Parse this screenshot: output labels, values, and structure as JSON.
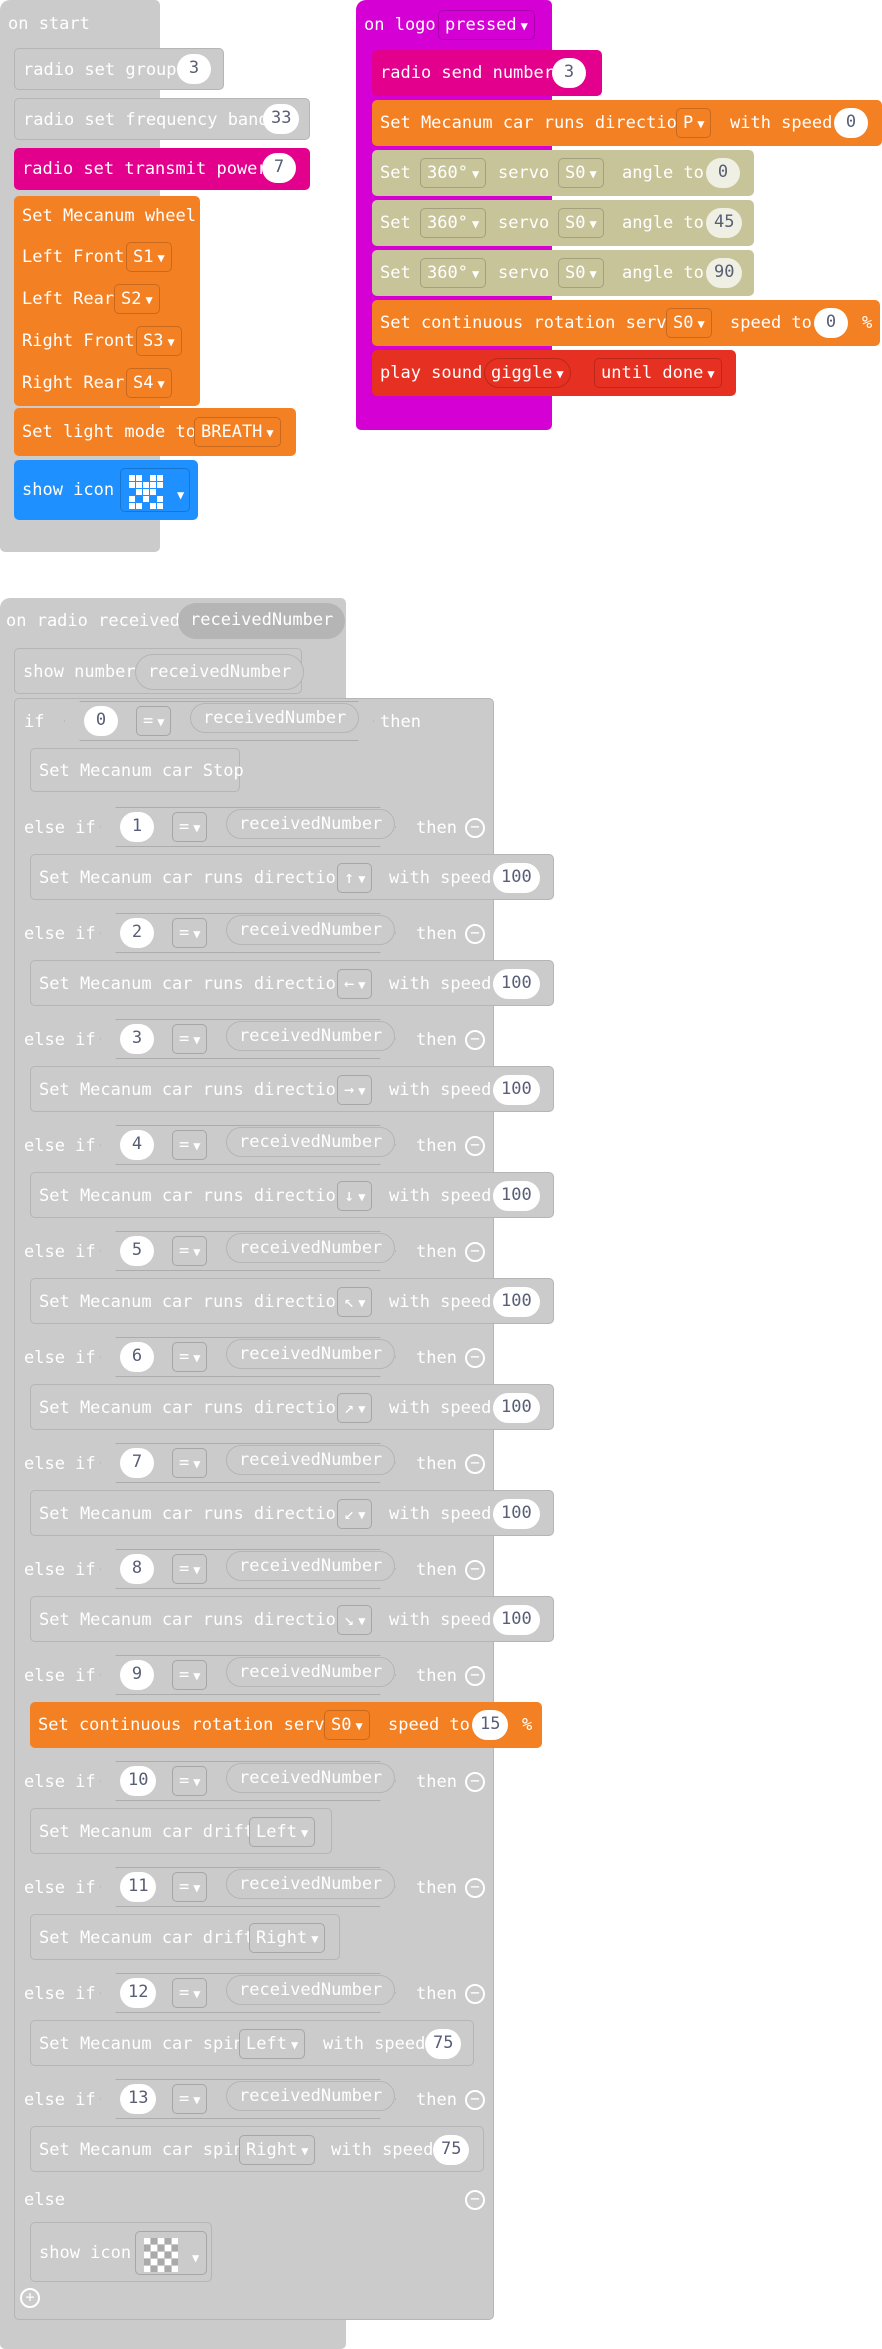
{
  "colors": {
    "gray_block": "#cbcbcb",
    "gray_dark": "#b5b5b5",
    "radio_pink": "#e3008c",
    "input_magenta": "#d400d4",
    "mecanum_orange": "#f48024",
    "servo_khaki": "#c8c49a",
    "music_red": "#e63022",
    "basic_blue": "#1e90ff"
  },
  "on_start": {
    "header": "on start",
    "radio_group_label": "radio set group",
    "radio_group_value": "3",
    "radio_band_label": "radio set frequency band",
    "radio_band_value": "33",
    "radio_power_label": "radio set transmit power",
    "radio_power_value": "7",
    "wheel_title": "Set Mecanum wheel",
    "wheels": [
      {
        "label": "Left Front",
        "value": "S1"
      },
      {
        "label": "Left Rear",
        "value": "S2"
      },
      {
        "label": "Right Front",
        "value": "S3"
      },
      {
        "label": "Right Rear",
        "value": "S4"
      }
    ],
    "light_mode_label": "Set light mode to",
    "light_mode_value": "BREATH",
    "show_icon_label": "show icon",
    "icon_name": "heart-small-icon"
  },
  "on_logo": {
    "header": "on logo",
    "event": "pressed",
    "send_label": "radio send number",
    "send_value": "3",
    "car_dir_label": "Set Mecanum car runs direction",
    "car_dir_value": "P",
    "with_speed": "with speed",
    "car_speed": "0",
    "servo_rows": [
      {
        "set": "Set",
        "type": "360°",
        "servo": "servo",
        "port": "S0",
        "angle_to": "angle to",
        "angle": "0"
      },
      {
        "set": "Set",
        "type": "360°",
        "servo": "servo",
        "port": "S0",
        "angle_to": "angle to",
        "angle": "45"
      },
      {
        "set": "Set",
        "type": "360°",
        "servo": "servo",
        "port": "S0",
        "angle_to": "angle to",
        "angle": "90"
      }
    ],
    "cont_servo_label": "Set continuous rotation servo",
    "cont_servo_port": "S0",
    "speed_to": "speed to",
    "cont_servo_speed": "0",
    "percent": "%",
    "sound_label": "play sound",
    "sound_value": "giggle",
    "sound_mode": "until done"
  },
  "on_radio": {
    "header": "on radio received",
    "var": "receivedNumber",
    "show_number_label": "show number",
    "if_label": "if",
    "else_if_label": "else if",
    "else_label": "else",
    "then_label": "then",
    "op": "=",
    "first_value": "0",
    "stop_label": "Set Mecanum car Stop",
    "dir_label": "Set Mecanum car runs direction",
    "with_speed": "with speed",
    "directions": [
      {
        "n": "1",
        "arrow": "↑",
        "speed": "100"
      },
      {
        "n": "2",
        "arrow": "←",
        "speed": "100"
      },
      {
        "n": "3",
        "arrow": "→",
        "speed": "100"
      },
      {
        "n": "4",
        "arrow": "↓",
        "speed": "100"
      },
      {
        "n": "5",
        "arrow": "↖",
        "speed": "100"
      },
      {
        "n": "6",
        "arrow": "↗",
        "speed": "100"
      },
      {
        "n": "7",
        "arrow": "↙",
        "speed": "100"
      },
      {
        "n": "8",
        "arrow": "↘",
        "speed": "100"
      }
    ],
    "servo_case": {
      "n": "9",
      "label": "Set continuous rotation servo",
      "port": "S0",
      "speed_to": "speed to",
      "speed": "15",
      "percent": "%"
    },
    "drift_cases": [
      {
        "n": "10",
        "label": "Set Mecanum car drift",
        "value": "Left"
      },
      {
        "n": "11",
        "label": "Set Mecanum car drift",
        "value": "Right"
      }
    ],
    "spin_cases": [
      {
        "n": "12",
        "label": "Set Mecanum car spin",
        "value": "Left",
        "speed": "75"
      },
      {
        "n": "13",
        "label": "Set Mecanum car spin",
        "value": "Right",
        "speed": "75"
      }
    ],
    "else_show_icon": "show icon",
    "else_icon_name": "checkered-icon"
  }
}
